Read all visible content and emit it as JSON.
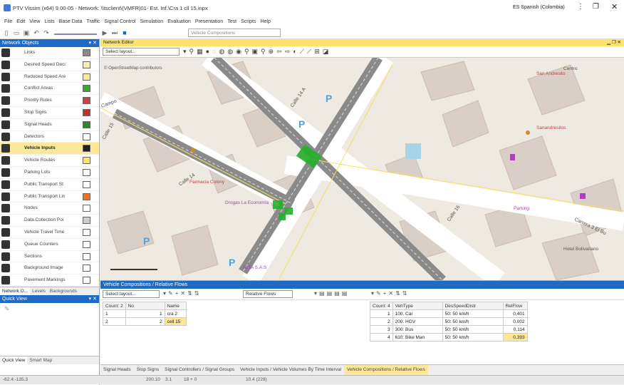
{
  "window": {
    "title": "PTV Vissim (x64) 9.00-05 - Network: \\\\tsclient\\(VMFR)01- Est. Inf.\\Cra 1 cll 15.inpx",
    "language": "ES Spanish (Colombia)"
  },
  "menu": [
    "File",
    "Edit",
    "View",
    "Lists",
    "Base Data",
    "Traffic",
    "Signal Control",
    "Simulation",
    "Evaluation",
    "Presentation",
    "Test",
    "Scripts",
    "Help"
  ],
  "toolbar": {
    "combo": "Vehicle Compositions"
  },
  "network_objects": {
    "title": "Network Objects",
    "items": [
      {
        "label": "Links",
        "swatch": "#888888"
      },
      {
        "label": "Desired Speed Deci",
        "swatch": "#f4eeb0"
      },
      {
        "label": "Reduced Speed Are",
        "swatch": "#f8e8a0"
      },
      {
        "label": "Conflict Areas",
        "swatch": "#3aa830"
      },
      {
        "label": "Priority Rules",
        "swatch": "#d24040"
      },
      {
        "label": "Stop Signs",
        "swatch": "#c03030"
      },
      {
        "label": "Signal Heads",
        "swatch": "#2c8a2c"
      },
      {
        "label": "Detectors",
        "swatch": "#ffffff"
      },
      {
        "label": "Vehicle Inputs",
        "swatch": "#222222",
        "selected": true
      },
      {
        "label": "Vehicle Routes",
        "swatch": "#ffe070"
      },
      {
        "label": "Parking Lots",
        "swatch": "#ffffff"
      },
      {
        "label": "Public Transport St",
        "swatch": "#ffffff"
      },
      {
        "label": "Public Transport Lin",
        "swatch": "#f07020"
      },
      {
        "label": "Nodes",
        "swatch": "#ffffff"
      },
      {
        "label": "Data Collection Poi",
        "swatch": "#cccccc"
      },
      {
        "label": "Vehicle Travel Time",
        "swatch": "#ffffff"
      },
      {
        "label": "Queue Counters",
        "swatch": "#ffffff"
      },
      {
        "label": "Sections",
        "swatch": "#ffffff"
      },
      {
        "label": "Background Image",
        "swatch": "#ffffff"
      },
      {
        "label": "Pavement Markings",
        "swatch": "#ffffff"
      }
    ],
    "tabs": [
      "Network O...",
      "Levels",
      "Backgrounds"
    ]
  },
  "quick_view": {
    "title": "Quick View",
    "tabs": [
      "Quick View",
      "Smart Map"
    ]
  },
  "editor": {
    "title": "Network Editor",
    "layout": "Select layout...",
    "credit": "© OpenStreetMap contributors",
    "labels": [
      "Calle 14 A",
      "Calle 14",
      "Calle 15",
      "Calle 16",
      "Carrera 3 El Bu",
      "Farmacia Colony",
      "Drogas La Economía",
      "ALTA S.A.S",
      "San Andresito",
      "Sanandresitos",
      "Parking",
      "Hotel Bolivariano",
      "Centro",
      "Campo"
    ]
  },
  "bottom": {
    "title": "Vehicle Compositions / Relative Flows",
    "layout": "Select layout...",
    "relflows_combo": "Relative Flows",
    "left_table": {
      "headers": [
        "Count: 2",
        "No",
        "Name"
      ],
      "rows": [
        [
          "1",
          "1",
          "cra 2"
        ],
        [
          "2",
          "2",
          "cell 15"
        ]
      ]
    },
    "right_table": {
      "headers": [
        "Count: 4",
        "VehType",
        "DesSpeedDistr",
        "RelFlow"
      ],
      "rows": [
        [
          "1",
          "100: Car",
          "50: 50 km/h",
          "0,401"
        ],
        [
          "2",
          "200: HGV",
          "50: 50 km/h",
          "0,002"
        ],
        [
          "3",
          "300: Bus",
          "50: 50 km/h",
          "0,114"
        ],
        [
          "4",
          "610: Bike Man",
          "50: 50 km/h",
          "0,393"
        ]
      ]
    },
    "tabs": [
      "Signal Heads",
      "Stop Signs",
      "Signal Controllers / Signal Groups",
      "Vehicle Inputs / Vehicle Volumes By Time Interval",
      "Vehicle Compositions / Relative Flows"
    ]
  },
  "status": {
    "coords": "-62.4:-135.3",
    "a": "200.10",
    "b": "3.1",
    "c": "18 + 0",
    "d": "10.4 (229)"
  }
}
